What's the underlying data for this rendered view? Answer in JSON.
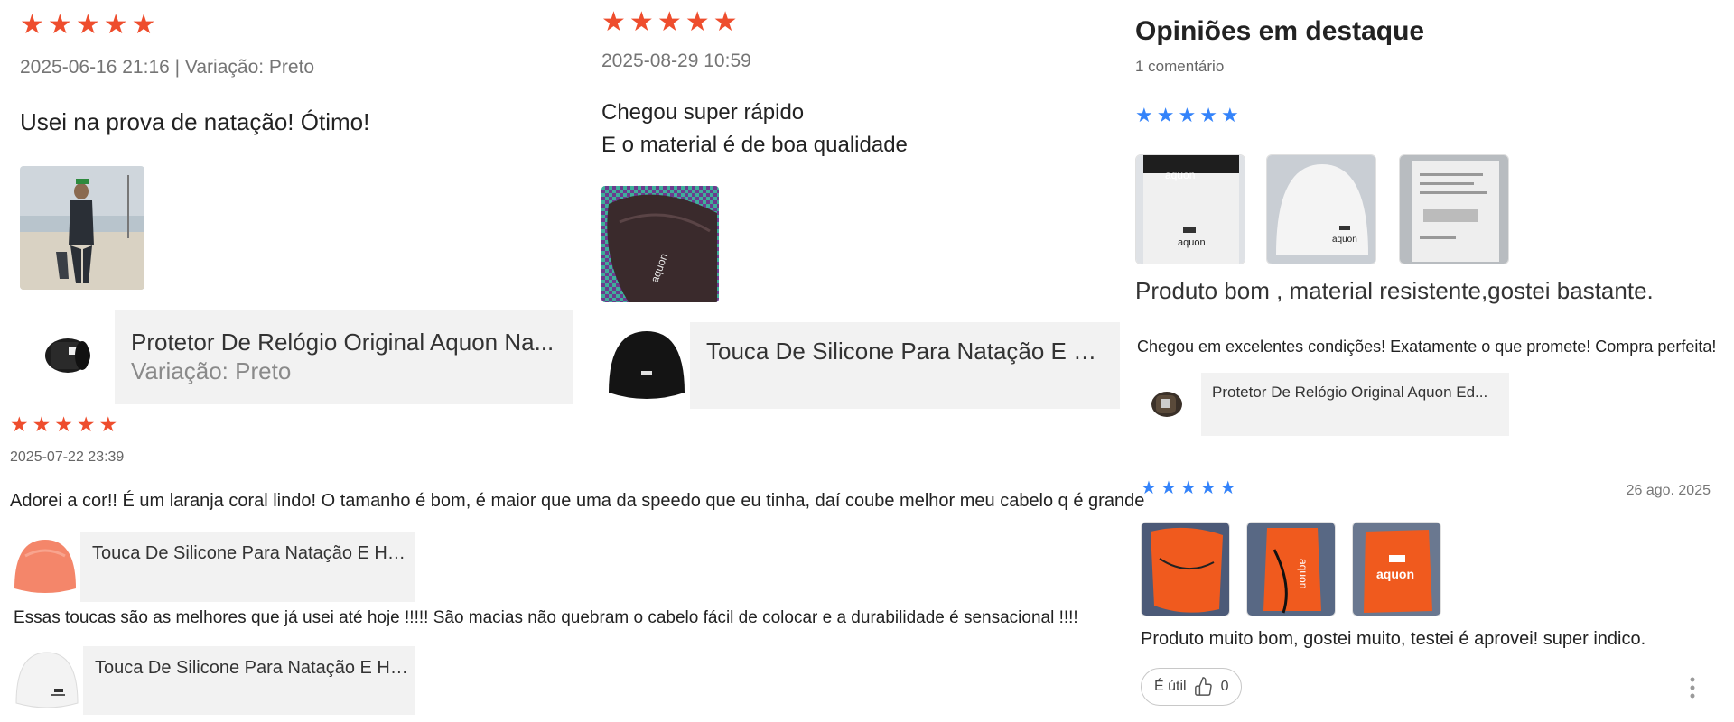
{
  "reviews_left": [
    {
      "stars": 5,
      "meta": "2025-06-16 21:16 | Variação: Preto",
      "text": "Usei na prova de natação! Ótimo!",
      "product": {
        "name": "Protetor De Relógio Original Aquon Na...",
        "variation": "Variação: Preto"
      }
    },
    {
      "stars": 5,
      "meta": "2025-08-29 10:59",
      "text_lines": [
        "Chegou super rápido",
        "E o material é de boa qualidade"
      ],
      "product": {
        "name": "Touca De Silicone Para Natação E Hid..."
      }
    },
    {
      "stars": 5,
      "meta": "2025-07-22 23:39",
      "text": "Adorei a cor!! É um laranja coral lindo! O tamanho é bom, é maior que uma da speedo que eu tinha, daí coube melhor meu cabelo q é grande",
      "product": {
        "name": "Touca De Silicone Para Natação E Hid..."
      }
    },
    {
      "text": "Essas toucas são as melhores que já usei até hoje !!!!! São macias não quebram o cabelo fácil de colocar e a durabilidade é sensacional !!!!",
      "product": {
        "name": "Touca De Silicone Para Natação E Hid..."
      }
    }
  ],
  "featured": {
    "title": "Opiniões em destaque",
    "count": "1 comentário",
    "review1": {
      "stars": 5,
      "text": "Produto bom , material resistente,gostei bastante.",
      "subtext": "Chegou em excelentes condições! Exatamente o que promete! Compra perfeita!",
      "product": {
        "name": "Protetor De Relógio Original Aquon Ed..."
      }
    },
    "review2": {
      "stars": 5,
      "date": "26 ago. 2025",
      "text": "Produto muito bom, gostei muito, testei é aprovei! super indico.",
      "helpful_label": "É útil",
      "helpful_count": "0"
    }
  },
  "colors": {
    "star_orange": "#ee4d2d",
    "star_blue": "#3483fa",
    "product_bg": "#f2f2f2"
  },
  "icons": {
    "star": "★",
    "thumbs_up": "thumbs-up-icon",
    "more": "more-vertical-icon"
  }
}
